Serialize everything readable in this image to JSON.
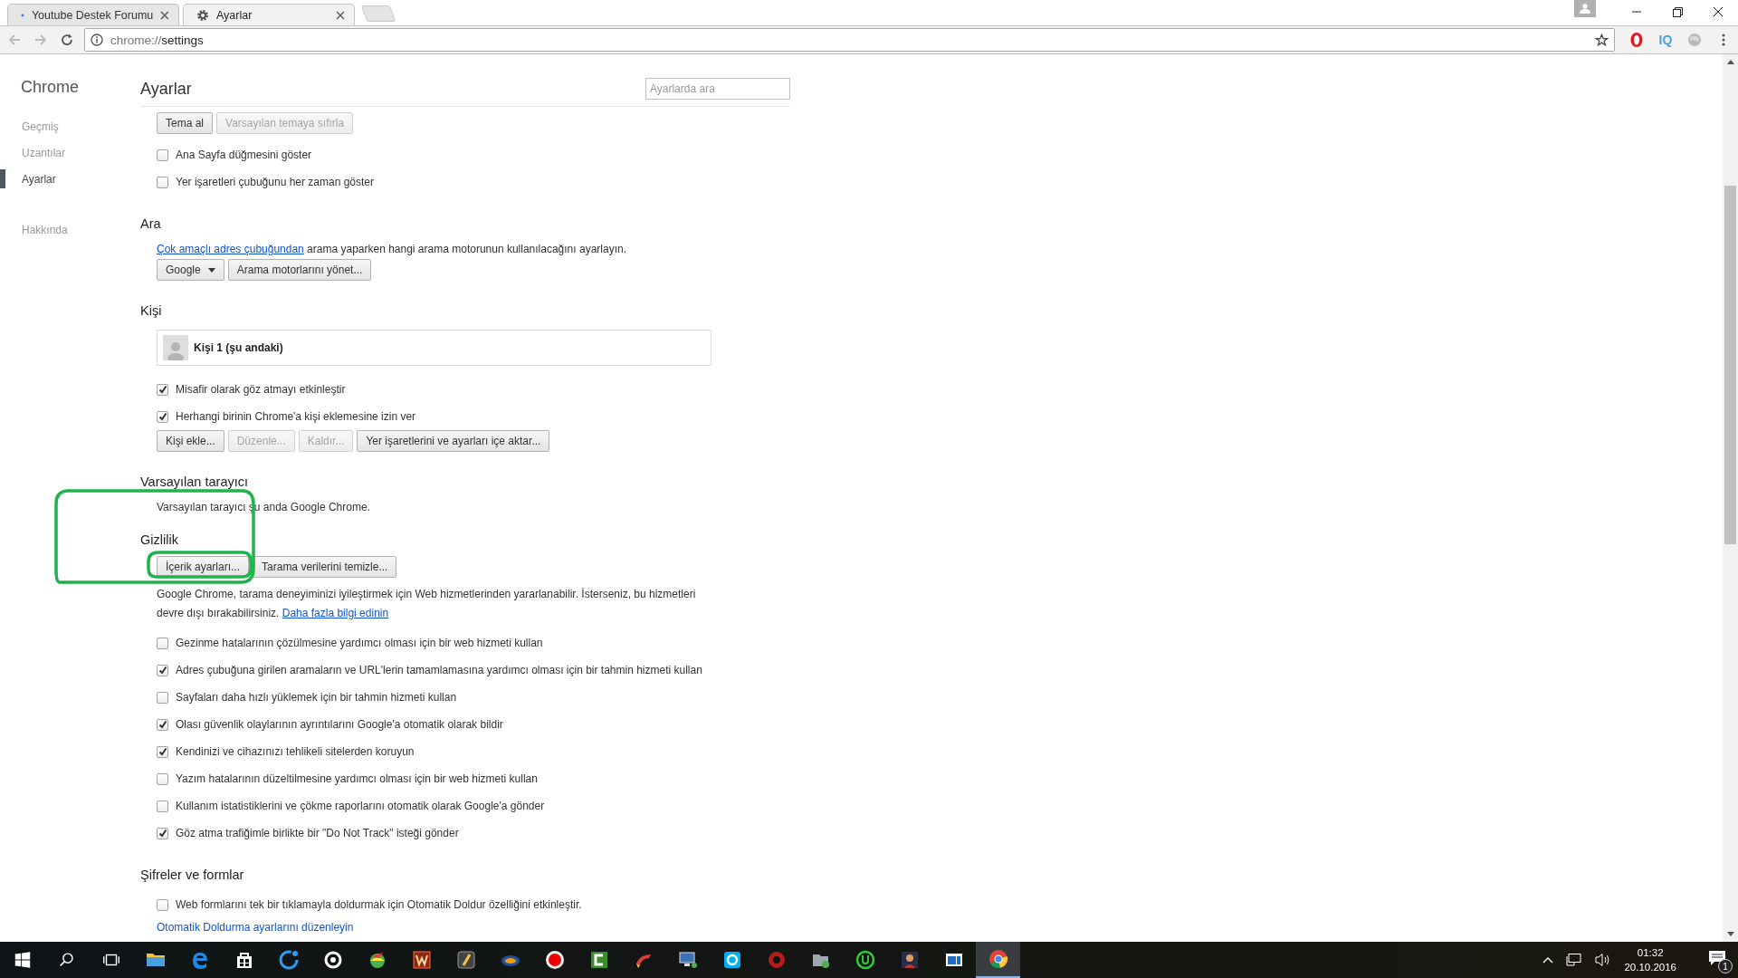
{
  "tabs": [
    {
      "title": "Youtube Destek Forumu",
      "selected": false
    },
    {
      "title": "Ayarlar",
      "selected": true
    }
  ],
  "toolbar": {
    "url_scheme": "chrome://",
    "url_path": "settings",
    "extension_label": "IQ"
  },
  "sidebar": {
    "title": "Chrome",
    "groups": [
      {
        "items": [
          {
            "label": "Geçmiş",
            "selected": false
          },
          {
            "label": "Uzantılar",
            "selected": false
          },
          {
            "label": "Ayarlar",
            "selected": true
          }
        ]
      },
      {
        "items": [
          {
            "label": "Hakkında",
            "selected": false
          }
        ]
      }
    ]
  },
  "header": {
    "title": "Ayarlar",
    "search_placeholder": "Ayarlarda ara"
  },
  "sections": [
    {
      "items": [
        {
          "kind": "buttons",
          "buttons": [
            {
              "kind": "button",
              "label": "Tema al",
              "disabled": false
            },
            {
              "kind": "button",
              "label": "Varsayılan temaya sıfırla",
              "disabled": true
            }
          ]
        },
        {
          "kind": "checkbox",
          "label": "Ana Sayfa düğmesini göster",
          "checked": false
        },
        {
          "kind": "checkbox",
          "label": "Yer işaretleri çubuğunu her zaman göster",
          "checked": false
        }
      ]
    },
    {
      "title": "Ara",
      "items": [
        {
          "kind": "text",
          "parts": [
            {
              "text": "Çok amaçlı adres çubuğundan",
              "link": true
            },
            {
              "text": " arama yaparken hangi arama motorunun kullanılacağını ayarlayın.",
              "link": false
            }
          ]
        },
        {
          "kind": "buttons",
          "buttons": [
            {
              "kind": "select",
              "label": "Google",
              "disabled": false
            },
            {
              "kind": "button",
              "label": "Arama motorlarını yönet...",
              "disabled": false
            }
          ]
        }
      ]
    },
    {
      "title": "Kişi",
      "items": [
        {
          "kind": "profile",
          "name": "Kişi 1 (şu andaki)"
        },
        {
          "kind": "checkbox",
          "label": "Misafir olarak göz atmayı etkinleştir",
          "checked": true
        },
        {
          "kind": "checkbox",
          "label": "Herhangi birinin Chrome'a kişi eklemesine izin ver",
          "checked": true
        },
        {
          "kind": "buttons",
          "buttons": [
            {
              "kind": "button",
              "label": "Kişi ekle...",
              "disabled": false
            },
            {
              "kind": "button",
              "label": "Düzenle...",
              "disabled": true
            },
            {
              "kind": "button",
              "label": "Kaldır...",
              "disabled": true
            },
            {
              "kind": "button",
              "label": "Yer işaretlerini ve ayarları içe aktar...",
              "disabled": false
            }
          ]
        }
      ]
    },
    {
      "title": "Varsayılan tarayıcı",
      "items": [
        {
          "kind": "text",
          "parts": [
            {
              "text": "Varsayılan tarayıcı şu anda Google Chrome.",
              "link": false
            }
          ]
        }
      ]
    },
    {
      "title": "Gizlilik",
      "items": [
        {
          "kind": "buttons",
          "buttons": [
            {
              "kind": "button",
              "label": "İçerik ayarları...",
              "disabled": false
            },
            {
              "kind": "button",
              "label": "Tarama verilerini temizle...",
              "disabled": false
            }
          ]
        },
        {
          "kind": "text",
          "parts": [
            {
              "text": "Google Chrome, tarama deneyiminizi iyileştirmek için Web hizmetlerinden yararlanabilir. İsterseniz, bu hizmetleri devre dışı bırakabilirsiniz. ",
              "link": false
            },
            {
              "text": "Daha fazla bilgi edinin",
              "link": true
            }
          ]
        },
        {
          "kind": "checkbox",
          "label": "Gezinme hatalarının çözülmesine yardımcı olması için bir web hizmeti kullan",
          "checked": false
        },
        {
          "kind": "checkbox",
          "label": "Adres çubuğuna girilen aramaların ve URL'lerin tamamlamasına yardımcı olması için bir tahmin hizmeti kullan",
          "checked": true
        },
        {
          "kind": "checkbox",
          "label": "Sayfaları daha hızlı yüklemek için bir tahmin hizmeti kullan",
          "checked": false
        },
        {
          "kind": "checkbox",
          "label": "Olası güvenlik olaylarının ayrıntılarını Google'a otomatik olarak bildir",
          "checked": true
        },
        {
          "kind": "checkbox",
          "label": "Kendinizi ve cihazınızı tehlikeli sitelerden koruyun",
          "checked": true
        },
        {
          "kind": "checkbox",
          "label": "Yazım hatalarının düzeltilmesine yardımcı olması için bir web hizmeti kullan",
          "checked": false
        },
        {
          "kind": "checkbox",
          "label": "Kullanım istatistiklerini ve çökme raporlarını otomatik olarak Google'a gönder",
          "checked": false
        },
        {
          "kind": "checkbox",
          "label": "Göz atma trafiğimle birlikte bir \"Do Not Track\" isteği gönder",
          "checked": true
        }
      ]
    },
    {
      "title": "Şifreler ve formlar",
      "items": [
        {
          "kind": "checkbox",
          "label": "Web formlarını tek bir tıklamayla doldurmak için Otomatik Doldur özelliğini etkinleştir.",
          "checked": false
        },
        {
          "kind": "link",
          "label": "Otomatik Doldurma ayarlarını düzenleyin"
        }
      ]
    }
  ],
  "annotations": [
    {
      "kind": "outline"
    }
  ],
  "taskbar": {
    "apps": [
      {
        "selected": false
      },
      {
        "selected": false
      },
      {
        "selected": false
      },
      {
        "selected": false
      },
      {
        "selected": false
      },
      {
        "selected": false
      },
      {
        "selected": false
      },
      {
        "selected": false
      },
      {
        "selected": false
      },
      {
        "selected": false
      },
      {
        "selected": false
      },
      {
        "selected": false
      },
      {
        "selected": false
      },
      {
        "selected": false
      },
      {
        "selected": false
      },
      {
        "selected": false
      },
      {
        "selected": false
      },
      {
        "selected": false
      },
      {
        "selected": false
      },
      {
        "selected": true
      }
    ],
    "time": "01:32",
    "date": "20.10.2016",
    "notification_count": "1"
  }
}
